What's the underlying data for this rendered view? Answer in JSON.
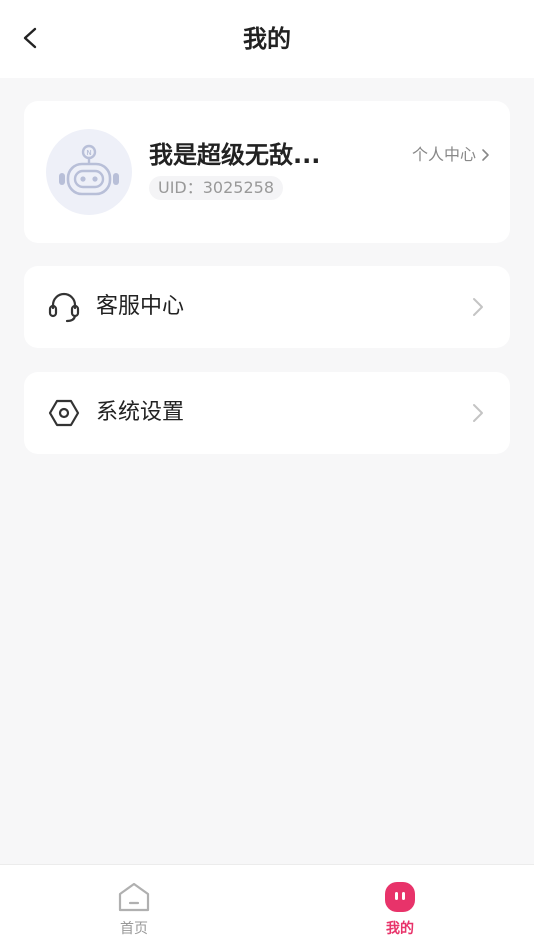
{
  "header": {
    "title": "我的",
    "back_icon": "back-arrow-icon"
  },
  "profile": {
    "avatar_icon": "robot-avatar-icon",
    "nickname": "我是超级无敌...",
    "uid": "UID：3025258",
    "personal_center_label": "个人中心",
    "personal_center_icon": "chevron-right-icon"
  },
  "menu": {
    "items": [
      {
        "label": "客服中心",
        "icon": "headset-icon"
      },
      {
        "label": "系统设置",
        "icon": "settings-hexagon-icon"
      }
    ]
  },
  "tabbar": {
    "items": [
      {
        "label": "首页",
        "icon": "home-icon",
        "active": false
      },
      {
        "label": "我的",
        "icon": "mine-icon",
        "active": true
      }
    ],
    "active_color": "#e8336a",
    "inactive_color": "#999999"
  }
}
